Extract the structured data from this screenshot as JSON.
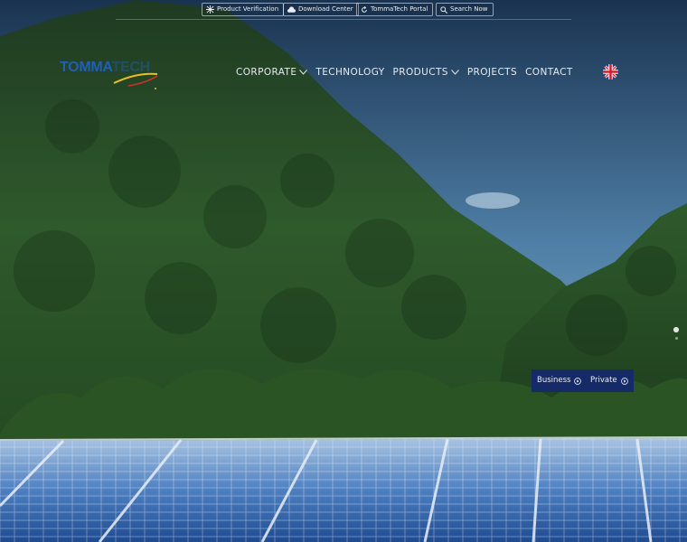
{
  "topbar": {
    "links": [
      {
        "label": "Product Verification",
        "icon": "verification-icon"
      },
      {
        "label": "Download Center",
        "icon": "cloud-download-icon"
      },
      {
        "label": "TommaTech Portal",
        "icon": "refresh-icon"
      },
      {
        "label": "Search Now",
        "icon": "search-icon"
      }
    ]
  },
  "logo": {
    "part1": "TOMMA",
    "part2": "TECH"
  },
  "nav": {
    "items": [
      {
        "label": "CORPORATE",
        "dropdown": true
      },
      {
        "label": "TECHNOLOGY",
        "dropdown": false
      },
      {
        "label": "PRODUCTS",
        "dropdown": true
      },
      {
        "label": "PROJECTS",
        "dropdown": false
      },
      {
        "label": "CONTACT",
        "dropdown": false
      }
    ]
  },
  "language": {
    "icon": "uk-flag-icon"
  },
  "hero": {
    "buttons": [
      {
        "label": "Business"
      },
      {
        "label": "Private"
      }
    ]
  },
  "colors": {
    "brand_blue": "#1f5fb8",
    "button_navy": "#152a66"
  }
}
